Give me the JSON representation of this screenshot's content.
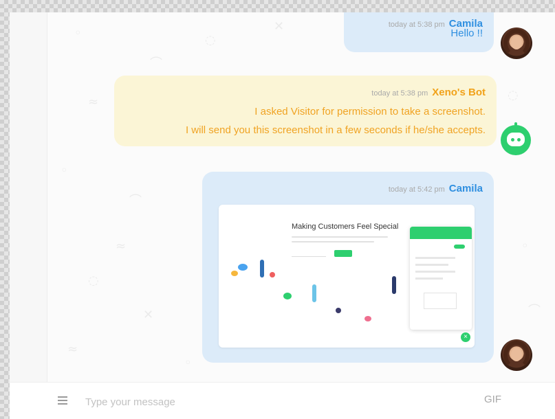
{
  "messages": [
    {
      "id": "hello",
      "timestamp": "today at 5:38 pm",
      "sender": "Camila",
      "lines": [
        "Hello !!"
      ]
    },
    {
      "id": "bot",
      "timestamp": "today at 5:38 pm",
      "sender": "Xeno's Bot",
      "lines": [
        "I asked Visitor for permission to take a screenshot.",
        "I will send you this screenshot in a few seconds if he/she accepts."
      ]
    },
    {
      "id": "screenshot",
      "timestamp": "today at 5:42 pm",
      "sender": "Camila",
      "attachment": {
        "headline": "Making Customers Feel Special"
      }
    }
  ],
  "composer": {
    "placeholder": "Type your message",
    "gif_label": "GIF"
  },
  "colors": {
    "agent_accent": "#2f8fe0",
    "bot_accent": "#f1a21a",
    "agent_bubble": "#dcebf9",
    "bot_bubble": "#fbf5d6",
    "brand_green": "#2ecf6f"
  },
  "icons": {
    "menu": "hamburger-menu-icon",
    "bot": "robot-icon",
    "avatar": "user-avatar"
  }
}
